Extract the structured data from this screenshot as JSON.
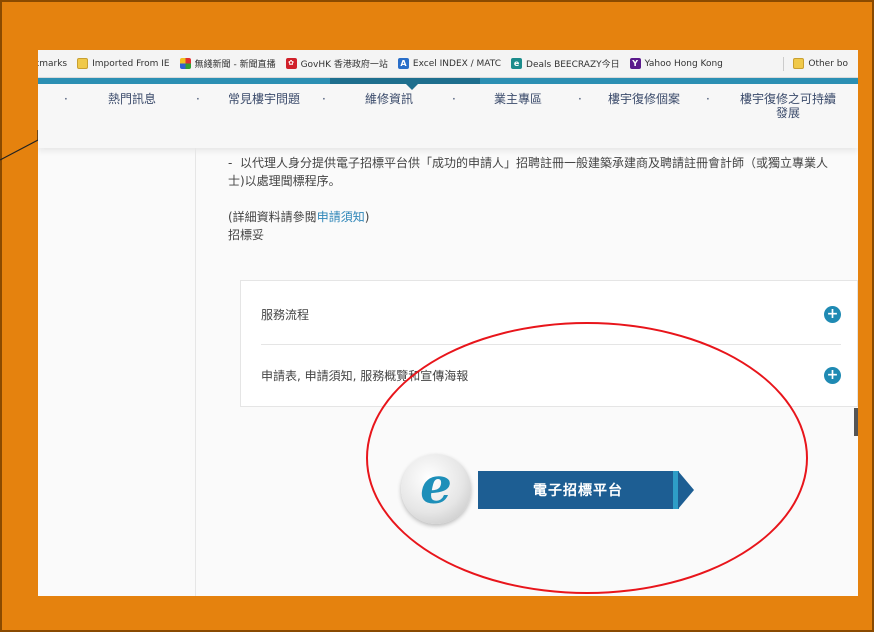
{
  "bookmarks": [
    {
      "label": "kmarks",
      "icon": "none"
    },
    {
      "label": "Imported From IE",
      "icon": "folder-icon"
    },
    {
      "label": "無綫新聞 - 新聞直播",
      "icon": "tvb-icon"
    },
    {
      "label": "GovHK 香港政府一站",
      "icon": "govhk-icon"
    },
    {
      "label": "Excel INDEX / MATC",
      "icon": "excel-icon"
    },
    {
      "label": "Deals BEECRAZY今日",
      "icon": "beecrazy-icon"
    },
    {
      "label": "Yahoo Hong Kong",
      "icon": "yahoo-icon"
    },
    {
      "label": "Other bo",
      "icon": "folder-icon"
    }
  ],
  "nav": {
    "items": [
      "熱門訊息",
      "常見樓宇問題",
      "維修資訊",
      "業主專區",
      "樓宇復修個案",
      "樓宇復修之可持續",
      "發展"
    ],
    "separator": "·",
    "active_index": 2,
    "accent_color": "#2b8fb3"
  },
  "content": {
    "paragraph_line1": "-  以代理人身分提供電子招標平台供「成功的申請人」招聘註冊一般建築承建商及聘請註冊會計師（或獨立專業人",
    "paragraph_line2": "士)以處理聞標程序。",
    "ref_prefix": "(詳細資料請參閱",
    "ref_link": "申請須知",
    "ref_suffix": ")",
    "tender_text": "招標妥"
  },
  "accordion": [
    {
      "label": "服務流程",
      "icon": "plus-icon"
    },
    {
      "label": "申請表, 申請須知, 服務概覽和宣傳海報",
      "icon": "plus-icon"
    }
  ],
  "etender": {
    "label": "電子招標平台",
    "icon_glyph": "e",
    "bar_color": "#1d5e93"
  },
  "colors": {
    "frame_background": "#e5820e",
    "annotation_ellipse": "#e8151b",
    "link": "#2f86b8"
  }
}
